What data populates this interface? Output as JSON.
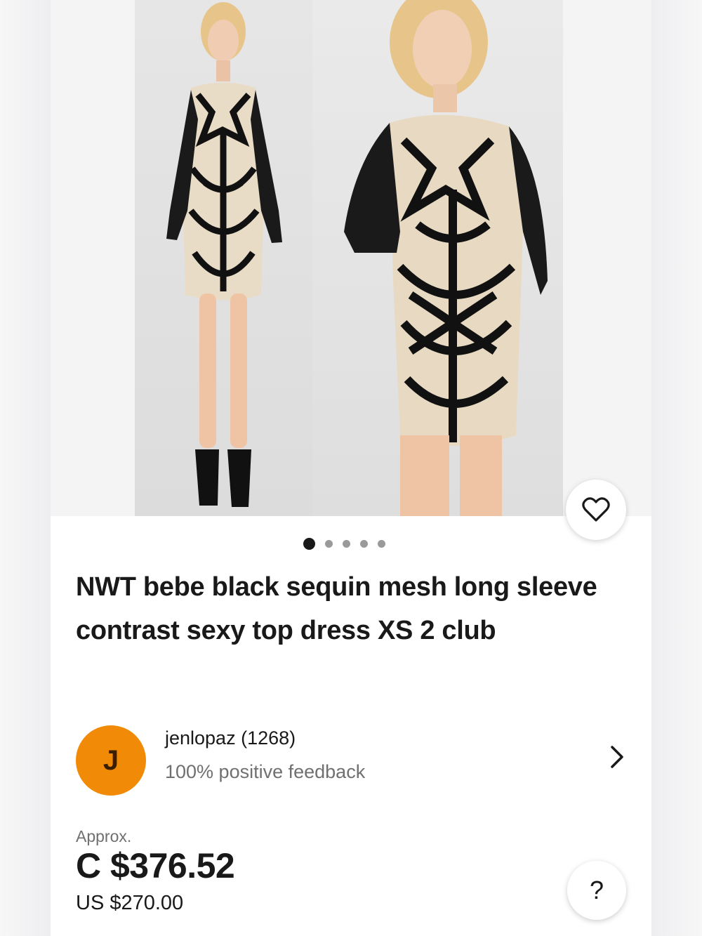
{
  "listing": {
    "title": "NWT bebe black sequin mesh long sleeve contrast sexy top dress XS 2 club",
    "image_count": 5,
    "active_image": 1
  },
  "seller": {
    "avatar_letter": "J",
    "name_score": "jenlopaz (1268)",
    "feedback": "100% positive feedback",
    "avatar_color": "#f18a06"
  },
  "price": {
    "approx_label": "Approx.",
    "converted": "C $376.52",
    "original": "US $270.00"
  },
  "actions": {
    "help_label": "?",
    "favorite_icon": "heart-icon",
    "seller_chevron_icon": "chevron-right-icon"
  }
}
